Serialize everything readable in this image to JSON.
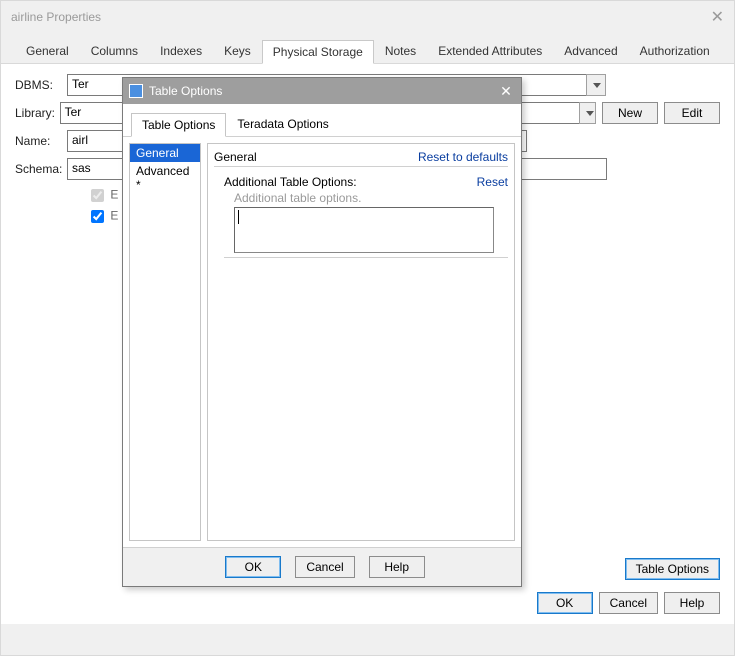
{
  "parentWindow": {
    "title": "airline Properties",
    "tabs": [
      "General",
      "Columns",
      "Indexes",
      "Keys",
      "Physical Storage",
      "Notes",
      "Extended Attributes",
      "Advanced",
      "Authorization"
    ],
    "activeTab": "Physical Storage",
    "labels": {
      "dbms": "DBMS:",
      "library": "Library:",
      "name": "Name:",
      "schema": "Schema:"
    },
    "fields": {
      "dbms": "Ter",
      "library": "Ter",
      "name": "airl",
      "schema": "sas"
    },
    "check1": "E",
    "check2": "E",
    "buttons": {
      "new": "New",
      "edit": "Edit",
      "tableOptions": "Table Options",
      "ok": "OK",
      "cancel": "Cancel",
      "help": "Help"
    }
  },
  "modal": {
    "title": "Table Options",
    "tabs": [
      "Table Options",
      "Teradata Options"
    ],
    "activeTab": "Table Options",
    "sidebar": [
      "General",
      "Advanced *"
    ],
    "sidebarSelected": "General",
    "panel": {
      "heading": "General",
      "resetDefaults": "Reset to defaults",
      "subheading": "Additional Table Options:",
      "reset": "Reset",
      "hint": "Additional table options.",
      "textValue": ""
    },
    "buttons": {
      "ok": "OK",
      "cancel": "Cancel",
      "help": "Help"
    }
  }
}
